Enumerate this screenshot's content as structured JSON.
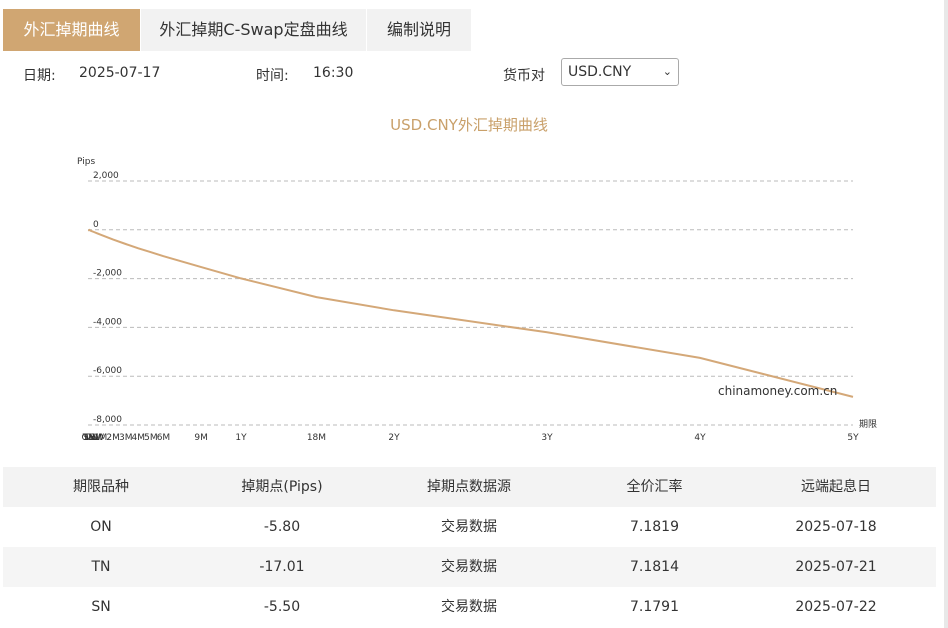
{
  "tabs": [
    {
      "label": "外汇掉期曲线",
      "active": true
    },
    {
      "label": "外汇掉期C-Swap定盘曲线",
      "active": false
    },
    {
      "label": "编制说明",
      "active": false
    }
  ],
  "filters": {
    "date_label": "日期:",
    "date_value": "2025-07-17",
    "time_label": "时间:",
    "time_value": "16:30",
    "pair_label": "货币对",
    "pair_value": "USD.CNY"
  },
  "chart_data": {
    "type": "line",
    "title": "USD.CNY外汇掉期曲线",
    "ylabel": "Pips",
    "xlabel": "期限",
    "watermark": "chinamoney.com.cn",
    "ylim": [
      -8000,
      2000
    ],
    "yticks": [
      "2,000",
      "0",
      "-2,000",
      "-4,000",
      "-6,000",
      "-8,000"
    ],
    "x_labels": [
      "ON",
      "TN",
      "SN",
      "1W",
      "2W",
      "3W",
      "1M",
      "2M",
      "3M",
      "4M",
      "5M",
      "6M",
      "9M",
      "1Y",
      "18M",
      "2Y",
      "3Y",
      "4Y",
      "5Y"
    ],
    "x_days": [
      1,
      2,
      3,
      7,
      14,
      21,
      30,
      60,
      90,
      120,
      150,
      180,
      270,
      365,
      545,
      730,
      1095,
      1460,
      1825
    ],
    "values": [
      -5.8,
      -17.01,
      -5.5,
      -40,
      -90,
      -140,
      -200,
      -400,
      -580,
      -760,
      -920,
      -1080,
      -1530,
      -1990,
      -2760,
      -3300,
      -4200,
      -5250,
      -6850
    ],
    "color": "#d4a878"
  },
  "table": {
    "headers": [
      "期限品种",
      "掉期点(Pips)",
      "掉期点数据源",
      "全价汇率",
      "远端起息日"
    ],
    "rows": [
      [
        "ON",
        "-5.80",
        "交易数据",
        "7.1819",
        "2025-07-18"
      ],
      [
        "TN",
        "-17.01",
        "交易数据",
        "7.1814",
        "2025-07-21"
      ],
      [
        "SN",
        "-5.50",
        "交易数据",
        "7.1791",
        "2025-07-22"
      ]
    ]
  }
}
